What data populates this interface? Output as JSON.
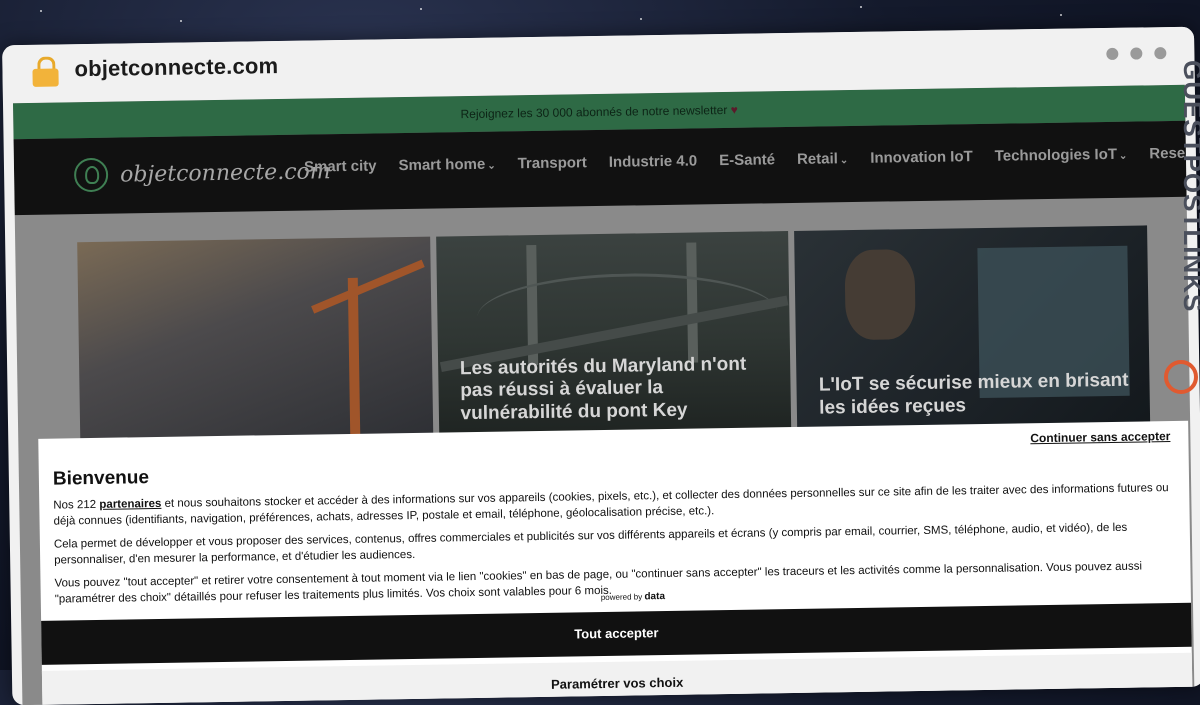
{
  "browser": {
    "url": "objetconnecte.com"
  },
  "site": {
    "newsletter": "Rejoignez les 30 000 abonnés de notre newsletter",
    "heart": "♥",
    "logo_text": "objetconnecte.com",
    "menu": [
      {
        "label": "Smart city"
      },
      {
        "label": "Smart home",
        "chevron": "⌄"
      },
      {
        "label": "Transport"
      },
      {
        "label": "Industrie 4.0"
      },
      {
        "label": "E-Santé"
      },
      {
        "label": "Retail",
        "chevron": "⌄"
      },
      {
        "label": "Innovation IoT"
      },
      {
        "label": "Technologies IoT",
        "chevron": "⌄"
      },
      {
        "label": "Reseaux"
      }
    ],
    "cards": [
      {
        "title": ""
      },
      {
        "title": "Les autorités du Maryland n'ont pas réussi à évaluer la vulnérabilité du pont Key"
      },
      {
        "title": "L'IoT se sécurise mieux en brisant les idées reçues"
      }
    ]
  },
  "consent": {
    "continue_label": "Continuer sans accepter",
    "title": "Bienvenue",
    "p1_pre": "Nos 212",
    "p1_link": "partenaires",
    "p1_post": "et nous souhaitons stocker et accéder à des informations sur vos appareils (cookies, pixels, etc.), et collecter des données personnelles sur ce site afin de les traiter avec des informations futures ou déjà connues (identifiants, navigation, préférences, achats, adresses IP, postale et email, téléphone, géolocalisation précise, etc.).",
    "p2": "Cela permet de développer et vous proposer des services, contenus, offres commerciales et publicités sur vos différents appareils et écrans (y compris par email, courrier, SMS, téléphone, audio, et vidéo), de les personnaliser, d'en mesurer la performance, et d'étudier les audiences.",
    "p3": "Vous pouvez \"tout accepter\" et retirer votre consentement à tout moment via le lien \"cookies\" en bas de page, ou \"continuer sans accepter\" les traceurs et les activités comme la personnalisation. Vous pouvez aussi \"paramétrer des choix\" détaillés pour refuser les traitements plus limités. Vos choix sont valables pour 6 mois.",
    "powered_by": "powered by",
    "powered_brand": "data",
    "accept_label": "Tout accepter",
    "param_label": "Paramétrer vos choix"
  },
  "watermark": {
    "text": "GUESTPOSTLINKS"
  },
  "colors": {
    "newsbar": "#2e6a45",
    "nav": "#111111",
    "accent": "#e05a30"
  }
}
